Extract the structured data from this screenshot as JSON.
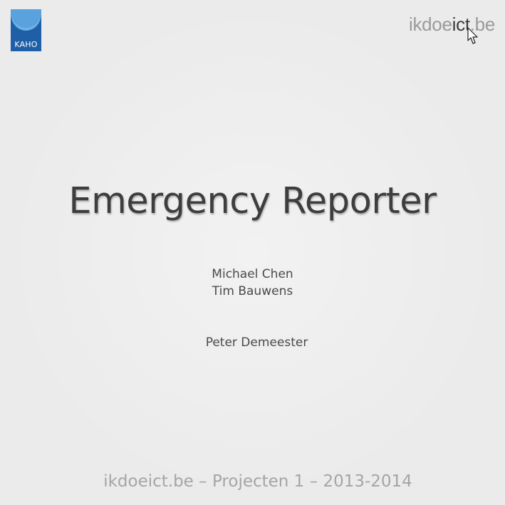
{
  "logo": {
    "text": "KAHO",
    "color": "#1f5fa7"
  },
  "site_mark": {
    "part_a": "ikdoe",
    "part_b": "ict",
    "part_c": ".be"
  },
  "slide": {
    "title": "Emergency Reporter",
    "authors": [
      "Michael Chen",
      "Tim Bauwens"
    ],
    "supervisor": "Peter Demeester",
    "footer": "ikdoeict.be – Projecten 1 – 2013-2014"
  },
  "cursor": {
    "icon": "arrow-cursor-icon"
  }
}
